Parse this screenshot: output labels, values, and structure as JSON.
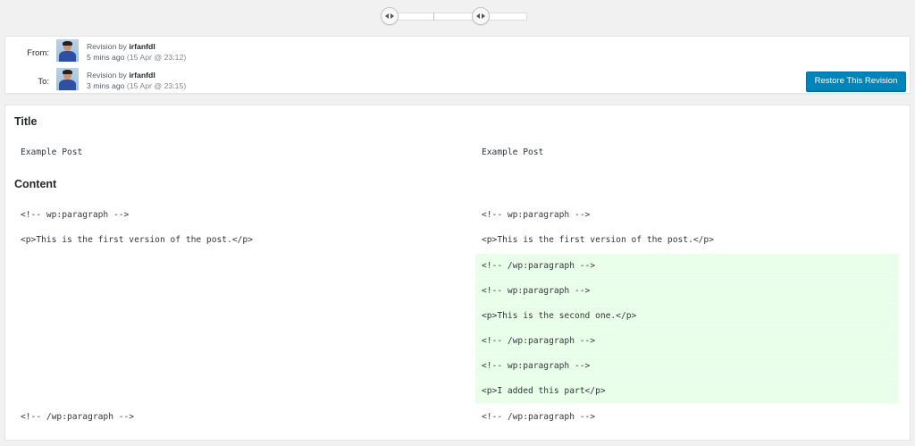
{
  "revisions": {
    "from": {
      "label": "From:",
      "prefix": "Revision by",
      "author": "irfanfdl",
      "ago": "5 mins ago",
      "date": "(15 Apr @ 23:12)"
    },
    "to": {
      "label": "To:",
      "prefix": "Revision by",
      "author": "irfanfdl",
      "ago": "3 mins ago",
      "date": "(15 Apr @ 23:15)"
    },
    "restore_label": "Restore This Revision"
  },
  "colors": {
    "accent": "#0085ba",
    "added_bg": "#e9ffe9"
  },
  "diff": {
    "title_heading": "Title",
    "title_left": "Example Post",
    "title_right": "Example Post",
    "content_heading": "Content",
    "left": [
      "<!-- wp:paragraph -->",
      "<p>This is the first version of the post.</p>",
      "<!-- /wp:paragraph -->"
    ],
    "right": [
      "<!-- wp:paragraph -->",
      "<p>This is the first version of the post.</p>",
      "<!-- /wp:paragraph -->",
      "<!-- wp:paragraph -->",
      "<p>This is the second one.</p>",
      "<!-- /wp:paragraph -->",
      "<!-- wp:paragraph -->",
      "<p>I added this part</p>",
      "<!-- /wp:paragraph -->"
    ]
  }
}
